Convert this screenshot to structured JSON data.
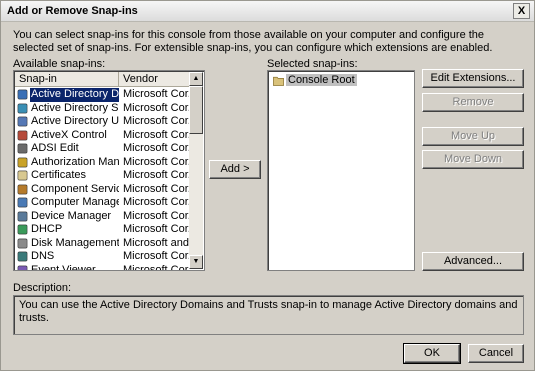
{
  "window": {
    "title": "Add or Remove Snap-ins",
    "close_label": "X"
  },
  "intro_text": "You can select snap-ins for this console from those available on your computer and configure the selected set of snap-ins. For extensible snap-ins, you can configure which extensions are enabled.",
  "available": {
    "label": "Available snap-ins:",
    "columns": {
      "snapin": "Snap-in",
      "vendor": "Vendor"
    },
    "rows": [
      {
        "name": "Active Directory Do...",
        "vendor": "Microsoft Cor...",
        "icon": "ad-domains-icon",
        "selected": true
      },
      {
        "name": "Active Directory Site...",
        "vendor": "Microsoft Cor...",
        "icon": "ad-sites-icon"
      },
      {
        "name": "Active Directory Use...",
        "vendor": "Microsoft Cor...",
        "icon": "ad-users-icon"
      },
      {
        "name": "ActiveX Control",
        "vendor": "Microsoft Cor...",
        "icon": "activex-icon"
      },
      {
        "name": "ADSI Edit",
        "vendor": "Microsoft Cor...",
        "icon": "adsi-edit-icon"
      },
      {
        "name": "Authorization Manager",
        "vendor": "Microsoft Cor...",
        "icon": "authorization-icon"
      },
      {
        "name": "Certificates",
        "vendor": "Microsoft Cor...",
        "icon": "certificates-icon"
      },
      {
        "name": "Component Services",
        "vendor": "Microsoft Cor...",
        "icon": "component-services-icon"
      },
      {
        "name": "Computer Managem...",
        "vendor": "Microsoft Cor...",
        "icon": "computer-management-icon"
      },
      {
        "name": "Device Manager",
        "vendor": "Microsoft Cor...",
        "icon": "device-manager-icon"
      },
      {
        "name": "DHCP",
        "vendor": "Microsoft Cor...",
        "icon": "dhcp-icon"
      },
      {
        "name": "Disk Management",
        "vendor": "Microsoft and...",
        "icon": "disk-management-icon"
      },
      {
        "name": "DNS",
        "vendor": "Microsoft Cor...",
        "icon": "dns-icon"
      },
      {
        "name": "Event Viewer",
        "vendor": "Microsoft Cor...",
        "icon": "event-viewer-icon"
      }
    ]
  },
  "add_button": "Add >",
  "selected": {
    "label": "Selected snap-ins:",
    "items": [
      {
        "name": "Console Root",
        "icon": "folder-icon"
      }
    ]
  },
  "buttons": {
    "edit_extensions": "Edit Extensions...",
    "remove": "Remove",
    "move_up": "Move Up",
    "move_down": "Move Down",
    "advanced": "Advanced..."
  },
  "description": {
    "label": "Description:",
    "text": "You can use the Active Directory Domains and Trusts snap-in to manage Active Directory domains and trusts."
  },
  "footer": {
    "ok": "OK",
    "cancel": "Cancel"
  },
  "colors": {
    "dialog_bg": "#d4d0c8",
    "selection": "#0a246a",
    "disabled_text": "#808080"
  }
}
